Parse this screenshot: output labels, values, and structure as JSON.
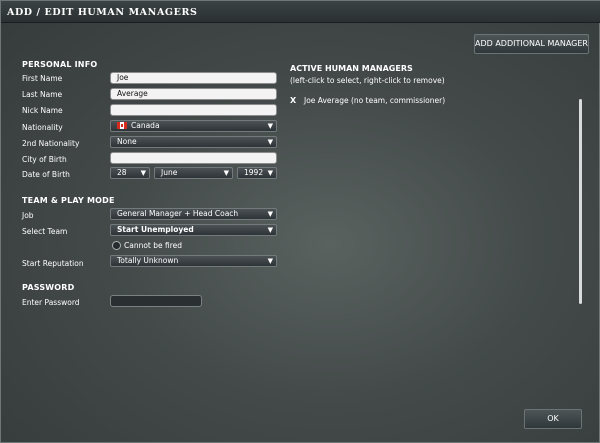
{
  "window": {
    "title": "ADD / EDIT HUMAN MANAGERS"
  },
  "buttons": {
    "add_manager": "ADD ADDITIONAL MANAGER",
    "ok": "OK"
  },
  "personal_info": {
    "heading": "PERSONAL INFO",
    "first_name": {
      "label": "First Name",
      "value": "Joe"
    },
    "last_name": {
      "label": "Last Name",
      "value": "Average"
    },
    "nick_name": {
      "label": "Nick Name",
      "value": ""
    },
    "nationality": {
      "label": "Nationality",
      "value": "Canada",
      "flag_icon": "canada-flag-icon"
    },
    "nationality2": {
      "label": "2nd Nationality",
      "value": "None"
    },
    "city_of_birth": {
      "label": "City of Birth",
      "value": ""
    },
    "date_of_birth": {
      "label": "Date of Birth",
      "day": "28",
      "month": "June",
      "year": "1992"
    }
  },
  "team_play": {
    "heading": "TEAM & PLAY MODE",
    "job": {
      "label": "Job",
      "value": "General Manager + Head Coach"
    },
    "select_team": {
      "label": "Select Team",
      "value": "Start Unemployed"
    },
    "cannot_be_fired": {
      "label": "Cannot be fired",
      "checked": false
    },
    "start_reputation": {
      "label": "Start Reputation",
      "value": "Totally Unknown"
    }
  },
  "password": {
    "heading": "PASSWORD",
    "enter_password": {
      "label": "Enter Password",
      "value": ""
    }
  },
  "active_managers": {
    "title": "ACTIVE HUMAN MANAGERS",
    "hint": "(left-click to select, right-click to remove)",
    "items": [
      {
        "remove_mark": "X",
        "name": "Joe Average (no team, commissioner)"
      }
    ]
  },
  "colors": {
    "dialog_bg": "#434a49",
    "titlebar_bg": "#2b3133",
    "field_bg": "#f3f3f3"
  }
}
